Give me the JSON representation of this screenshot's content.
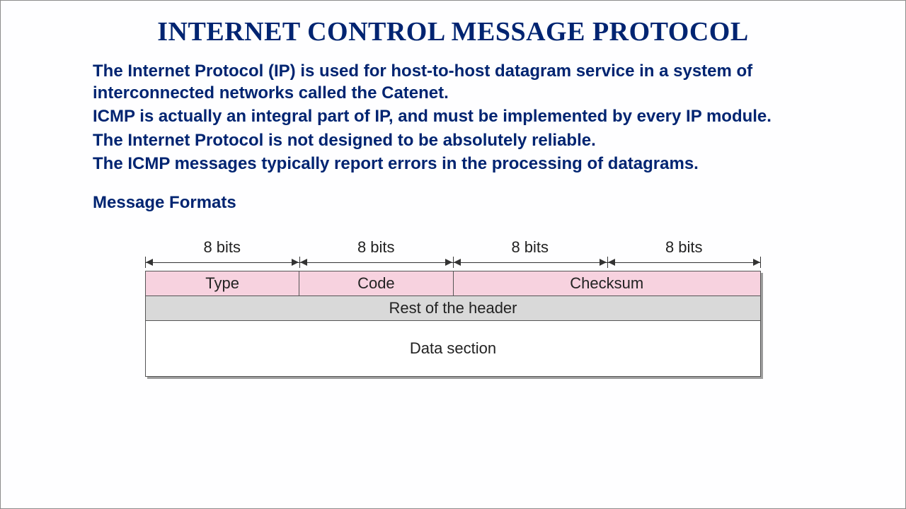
{
  "title": "INTERNET CONTROL MESSAGE PROTOCOL",
  "paragraphs": [
    "The Internet Protocol (IP) is used for host-to-host datagram service in a system of interconnected networks called the Catenet.",
    "ICMP is actually an integral part of IP, and must be implemented by every IP module.",
    "The Internet Protocol is not designed to be absolutely reliable.",
    "The ICMP messages typically report errors in the processing of datagrams."
  ],
  "section_heading": "Message Formats",
  "diagram": {
    "bit_labels": [
      "8 bits",
      "8 bits",
      "8 bits",
      "8 bits"
    ],
    "row1": {
      "type": "Type",
      "code": "Code",
      "checksum": "Checksum"
    },
    "row2": "Rest of the header",
    "row3": "Data section"
  }
}
